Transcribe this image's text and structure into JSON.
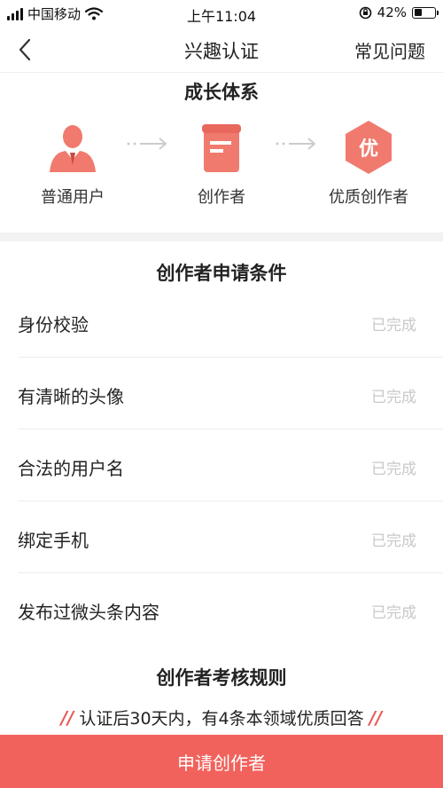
{
  "status_bar": {
    "carrier": "中国移动",
    "time": "上午11:04",
    "battery": "42%",
    "battery_level": 0.42
  },
  "nav": {
    "title": "兴趣认证",
    "faq": "常见问题"
  },
  "growth": {
    "title": "成长体系",
    "stages": [
      {
        "label": "普通用户",
        "icon": "user-icon"
      },
      {
        "label": "创作者",
        "icon": "document-icon"
      },
      {
        "label": "优质创作者",
        "icon": "quality-badge-icon",
        "badge_text": "优"
      }
    ]
  },
  "conditions": {
    "title": "创作者申请条件",
    "items": [
      {
        "label": "身份校验",
        "status": "已完成"
      },
      {
        "label": "有清晰的头像",
        "status": "已完成"
      },
      {
        "label": "合法的用户名",
        "status": "已完成"
      },
      {
        "label": "绑定手机",
        "status": "已完成"
      },
      {
        "label": "发布过微头条内容",
        "status": "已完成"
      }
    ]
  },
  "rules": {
    "title": "创作者考核规则",
    "text": "认证后30天内，有4条本领域优质回答"
  },
  "apply_button": "申请创作者",
  "colors": {
    "accent": "#f2625c",
    "status_done": "#c8c8c8"
  }
}
